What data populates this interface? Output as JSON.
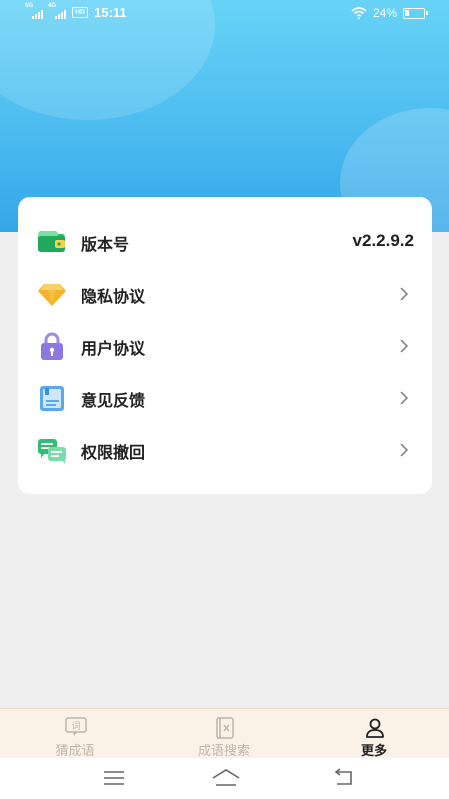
{
  "status_bar": {
    "sim1_tag": "5G",
    "sim2_tag": "4G",
    "hd_badge": "HD",
    "time": "15:11",
    "battery": "24%"
  },
  "settings": {
    "items": [
      {
        "label": "版本号",
        "value": "v2.2.9.2",
        "icon": "wallet-icon"
      },
      {
        "label": "隐私协议",
        "icon": "diamond-icon"
      },
      {
        "label": "用户协议",
        "icon": "lock-icon"
      },
      {
        "label": "意见反馈",
        "icon": "notebook-icon"
      },
      {
        "label": "权限撤回",
        "icon": "chat-bubbles-icon"
      }
    ]
  },
  "tab_bar": {
    "tabs": [
      {
        "label": "猜成语",
        "icon": "word-card-icon",
        "active": false
      },
      {
        "label": "成语搜索",
        "icon": "dictionary-icon",
        "active": false
      },
      {
        "label": "更多",
        "icon": "person-icon",
        "active": true
      }
    ]
  },
  "colors": {
    "header_top": "#67d3f7",
    "header_bottom": "#35a6e8",
    "tab_bar_bg": "#fbf2e7",
    "tab_inactive": "#bdb5ad",
    "tab_active": "#222222"
  }
}
